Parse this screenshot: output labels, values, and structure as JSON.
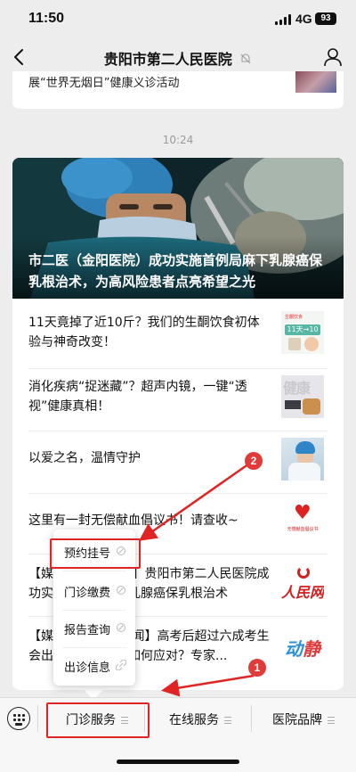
{
  "status": {
    "time": "11:50",
    "network": "4G",
    "battery": "93"
  },
  "nav": {
    "title": "贵阳市第二人民医院",
    "mute_icon": "bell-muted-icon",
    "back_icon": "chevron-left-icon",
    "user_icon": "user-icon"
  },
  "prev_article": {
    "title": "展“世界无烟日”健康义诊活动"
  },
  "timestamp": "10:24",
  "hero": {
    "title": "市二医（金阳医院）成功实施首例局麻下乳腺癌保乳根治术，为高风险患者点亮希望之光"
  },
  "articles": [
    {
      "title": "11天竟掉了近10斤？我们的生酮饮食初体验与神奇改变！",
      "thumb": {
        "label": "生酮饮食",
        "badge": "11天→10斤"
      }
    },
    {
      "title": "消化疾病“捉迷藏”？超声内镜，一键“透视”健康真相！",
      "thumb": {
        "label": "健康"
      }
    },
    {
      "title": "以爱之名，温情守护"
    },
    {
      "title": "这里有一封无偿献血倡议书！请查收~",
      "thumb": {
        "label": "无偿献血倡议书"
      }
    },
    {
      "title": "【媒体聚焦·人民网】贵阳市第二人民医院成功实施首例局麻下乳腺癌保乳根治术",
      "thumb": {
        "label": "人民网"
      }
    },
    {
      "title": "【媒体聚焦·动静新闻】高考后超过六成考生会出现这种问题，如何应对？专家...",
      "thumb": {
        "label1": "动",
        "label2": "静"
      }
    }
  ],
  "popup_menu": {
    "items": [
      {
        "label": "预约挂号",
        "icon": "link-icon"
      },
      {
        "label": "门诊缴费",
        "icon": "link-icon"
      },
      {
        "label": "报告查询",
        "icon": "link-icon"
      },
      {
        "label": "出诊信息",
        "icon": "link-icon"
      }
    ]
  },
  "bottom_menu": {
    "keyboard_icon": "keyboard-icon",
    "tabs": [
      {
        "label": "门诊服务"
      },
      {
        "label": "在线服务"
      },
      {
        "label": "医院品牌"
      }
    ]
  },
  "annotations": {
    "badge_1": "1",
    "badge_2": "2",
    "color": "#e02424"
  }
}
